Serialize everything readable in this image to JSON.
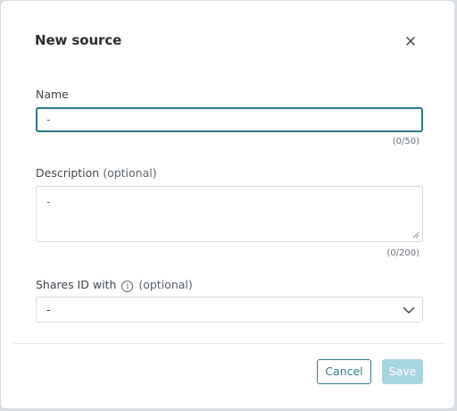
{
  "dialog": {
    "title": "New source",
    "close_icon": "close-icon"
  },
  "name_field": {
    "label": "Name",
    "value": "-",
    "counter": "(0/50)"
  },
  "description_field": {
    "label": "Description",
    "optional": "(optional)",
    "value": "-",
    "counter": "(0/200)"
  },
  "shares_id_field": {
    "label": "Shares ID with",
    "info_icon": "info-icon",
    "info_glyph": "i",
    "optional": "(optional)",
    "value": "-"
  },
  "footer": {
    "cancel_label": "Cancel",
    "save_label": "Save"
  },
  "colors": {
    "accent": "#2e7a86",
    "save_disabled": "#a9d5e1",
    "border": "#d4d9de"
  }
}
